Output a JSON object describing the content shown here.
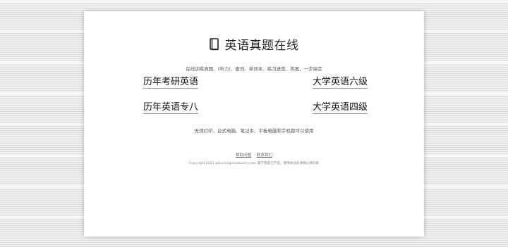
{
  "header": {
    "title": "英语真题在线",
    "icon": "book-icon"
  },
  "subtitle": "在线训练真题、(听力)、查词、单词本、练习进度、答案，一步搞定",
  "links": {
    "kaoyan": "历年考研英语",
    "liuji": "大学英语六级",
    "zhuanba": "历年英语专八",
    "siji": "大学英语四级"
  },
  "description": "无须打印，台式电脑、笔记本、平板电脑和手机都可以使用",
  "footer": {
    "help": "帮助问题",
    "contact": "联系我们",
    "copyright": "Copyright 2021 @burningvocabulary.com 属于我自己产品，使用本站前请确认我同意"
  },
  "colors": {
    "background": "#f2f2f2",
    "card": "#ffffff",
    "text": "#222222"
  }
}
